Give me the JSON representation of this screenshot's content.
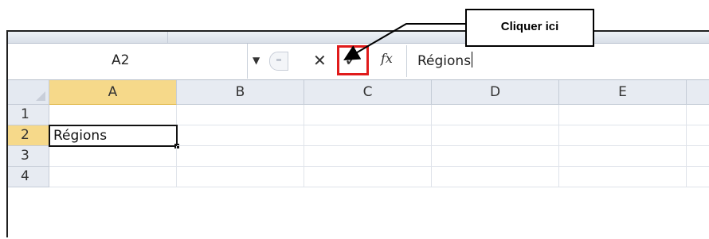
{
  "formula_bar": {
    "name_box": "A2",
    "name_dropdown_icon": "chevron-down-icon",
    "cancel_icon": "close-icon",
    "enter_icon": "checkmark-icon",
    "function_icon": "fx-icon",
    "fx_label": "fx",
    "formula_value": "Régions"
  },
  "callout": {
    "text": "Cliquer ici"
  },
  "columns": [
    "A",
    "B",
    "C",
    "D",
    "E"
  ],
  "rows": [
    "1",
    "2",
    "3",
    "4"
  ],
  "cells": {
    "A2": "Régions"
  },
  "colors": {
    "highlight": "#e01b1b",
    "selected_header": "#f6d98a"
  }
}
